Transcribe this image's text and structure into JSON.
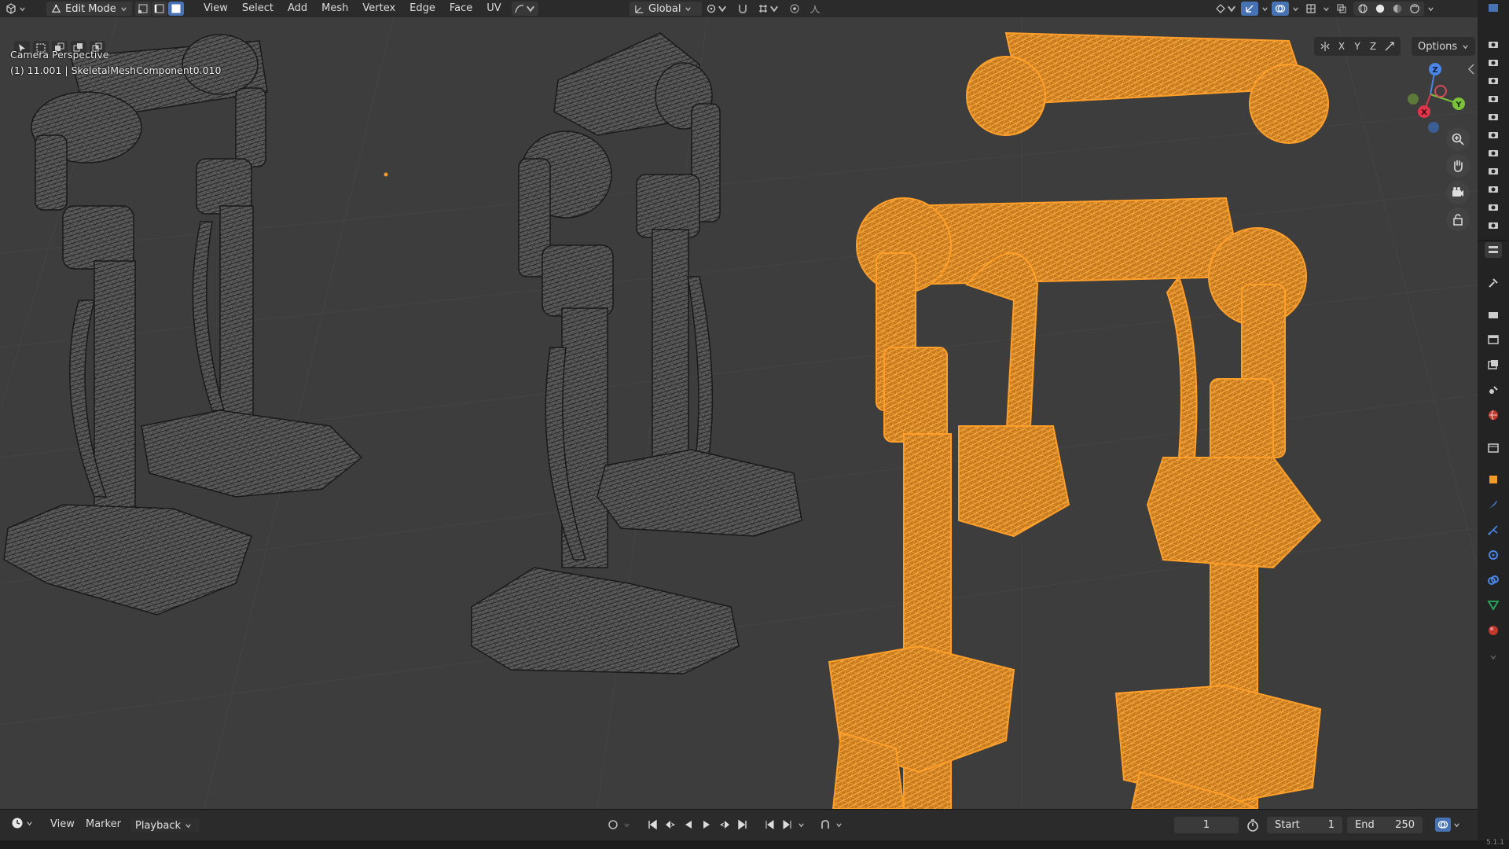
{
  "header": {
    "mode": "Edit Mode",
    "menus": [
      "View",
      "Select",
      "Add",
      "Mesh",
      "Vertex",
      "Edge",
      "Face",
      "UV"
    ],
    "transform_orientation": "Global"
  },
  "viewport": {
    "overlay_title": "Camera Perspective",
    "overlay_info": "(1) 11.001 | SkeletalMeshComponent0.010",
    "axis_lock_labels": [
      "X",
      "Y",
      "Z"
    ],
    "options_label": "Options",
    "gizmo_axes": [
      "X",
      "Y",
      "Z"
    ]
  },
  "timeline": {
    "menus": [
      "View",
      "Marker"
    ],
    "playback_label": "Playback",
    "current_frame": "1",
    "start_label": "Start",
    "start_value": "1",
    "end_label": "End",
    "end_value": "250"
  },
  "status": {
    "version": "5.1.1"
  },
  "colors": {
    "selected_mesh": "#f29a23",
    "unselected_wire": "#1c1c1c",
    "viewport_bg": "#3d3d3d",
    "accent": "#4772b3"
  }
}
